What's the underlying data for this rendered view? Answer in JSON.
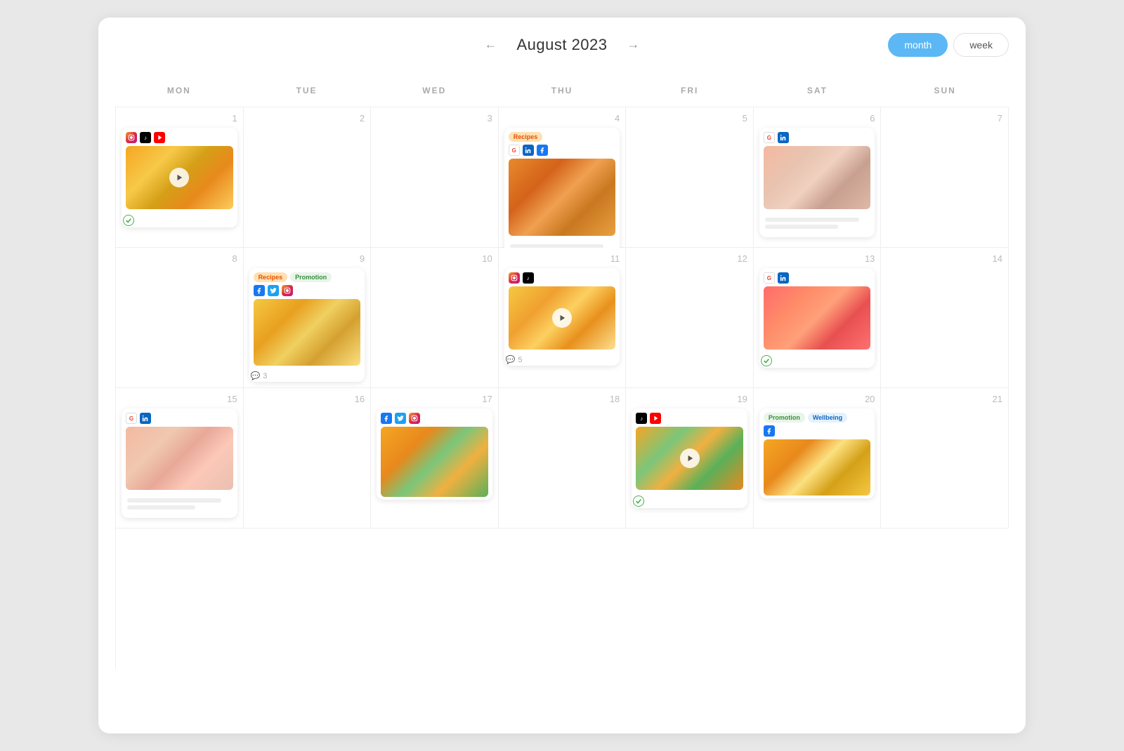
{
  "header": {
    "prev_arrow": "←",
    "next_arrow": "→",
    "title": "August 2023",
    "month_btn": "month",
    "week_btn": "week"
  },
  "days": [
    "MON",
    "TUE",
    "WED",
    "THU",
    "FRI",
    "SAT",
    "SUN"
  ],
  "cells": [
    {
      "date": 1,
      "has_post": true,
      "post": {
        "type": "video",
        "socials": [
          "instagram",
          "tiktok",
          "youtube"
        ],
        "image": "img-pineapple",
        "check": true
      }
    },
    {
      "date": 2,
      "has_post": false
    },
    {
      "date": 3,
      "has_post": false
    },
    {
      "date": 4,
      "has_post": true,
      "post": {
        "type": "image",
        "tags": [
          "Recipes"
        ],
        "socials": [
          "google",
          "linkedin",
          "facebook"
        ],
        "image": "img-orange-soup"
      }
    },
    {
      "date": 5,
      "has_post": false
    },
    {
      "date": 6,
      "has_post": true,
      "post": {
        "type": "image",
        "socials": [
          "google",
          "linkedin"
        ],
        "image": "img-drinks",
        "text_lines": true
      }
    },
    {
      "date": 7,
      "has_post": false
    },
    {
      "date": 8,
      "has_post": false
    },
    {
      "date": 9,
      "has_post": true,
      "post": {
        "type": "image",
        "tags": [
          "Recipes",
          "Promotion"
        ],
        "socials": [
          "facebook",
          "twitter",
          "instagram"
        ],
        "image": "img-smoothie",
        "comments": 3
      }
    },
    {
      "date": 10,
      "has_post": false
    },
    {
      "date": 11,
      "has_post": true,
      "post": {
        "type": "video",
        "socials": [
          "instagram",
          "tiktok"
        ],
        "image": "img-mango",
        "comments": 5
      }
    },
    {
      "date": 12,
      "has_post": false
    },
    {
      "date": 13,
      "has_post": true,
      "post": {
        "type": "image",
        "socials": [
          "google",
          "linkedin"
        ],
        "image": "img-citrus",
        "check": true
      }
    },
    {
      "date": 14,
      "has_post": false
    },
    {
      "date": 15,
      "has_post": true,
      "post": {
        "type": "image",
        "socials": [
          "google",
          "linkedin"
        ],
        "image": "img-peach-drink",
        "text_lines": true
      }
    },
    {
      "date": 16,
      "has_post": false
    },
    {
      "date": 17,
      "has_post": true,
      "post": {
        "type": "image",
        "socials": [
          "facebook",
          "twitter",
          "instagram"
        ],
        "image": "img-orange-leaves"
      }
    },
    {
      "date": 18,
      "has_post": false
    },
    {
      "date": 19,
      "has_post": true,
      "post": {
        "type": "video",
        "socials": [
          "tiktok",
          "youtube"
        ],
        "image": "img-clementines",
        "check": true
      }
    },
    {
      "date": 20,
      "has_post": true,
      "post": {
        "type": "image",
        "tags": [
          "Promotion",
          "Wellbeing"
        ],
        "socials": [
          "facebook"
        ],
        "image": "img-mixed"
      }
    },
    {
      "date": 21,
      "has_post": false
    }
  ],
  "colors": {
    "active_btn": "#5bb8f5",
    "border": "#eee",
    "date_color": "#bbb",
    "day_header_color": "#aaa"
  }
}
